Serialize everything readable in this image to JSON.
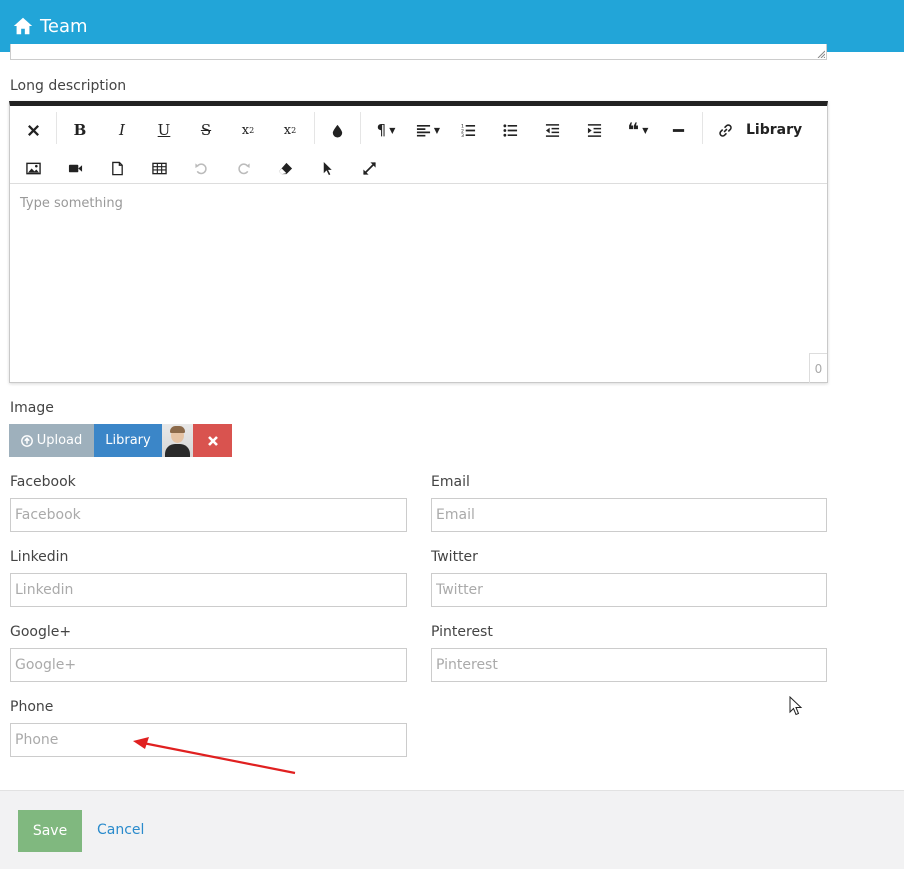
{
  "header": {
    "title": "Team",
    "icon": "home-icon"
  },
  "long_description": {
    "label": "Long description",
    "placeholder": "Type something",
    "counter": "0",
    "library_label": "Library"
  },
  "toolbar": {
    "icons": [
      "clear-format-icon",
      "bold-icon",
      "italic-icon",
      "underline-icon",
      "strikethrough-icon",
      "subscript-icon",
      "superscript-icon",
      "color-drop-icon",
      "paragraph-icon",
      "align-icon",
      "ordered-list-icon",
      "unordered-list-icon",
      "outdent-icon",
      "indent-icon",
      "quote-icon",
      "horizontal-rule-icon",
      "link-icon",
      "image-icon",
      "video-icon",
      "file-icon",
      "table-icon",
      "undo-icon",
      "redo-icon",
      "eraser-icon",
      "select-pointer-icon",
      "fullscreen-icon"
    ]
  },
  "image": {
    "label": "Image",
    "upload_label": "Upload",
    "library_label": "Library"
  },
  "fields": {
    "facebook": {
      "label": "Facebook",
      "placeholder": "Facebook",
      "value": ""
    },
    "email": {
      "label": "Email",
      "placeholder": "Email",
      "value": ""
    },
    "linkedin": {
      "label": "Linkedin",
      "placeholder": "Linkedin",
      "value": ""
    },
    "twitter": {
      "label": "Twitter",
      "placeholder": "Twitter",
      "value": ""
    },
    "googleplus": {
      "label": "Google+",
      "placeholder": "Google+",
      "value": ""
    },
    "pinterest": {
      "label": "Pinterest",
      "placeholder": "Pinterest",
      "value": ""
    },
    "phone": {
      "label": "Phone",
      "placeholder": "Phone",
      "value": ""
    }
  },
  "footer": {
    "save_label": "Save",
    "cancel_label": "Cancel"
  },
  "colors": {
    "header_bg": "#22a5d8",
    "upload_btn": "#9eb0bc",
    "library_btn": "#3b86c8",
    "remove_btn": "#d9534f",
    "save_btn": "#80b87f",
    "link": "#2a8bcc",
    "annotation_arrow": "#e02020"
  }
}
